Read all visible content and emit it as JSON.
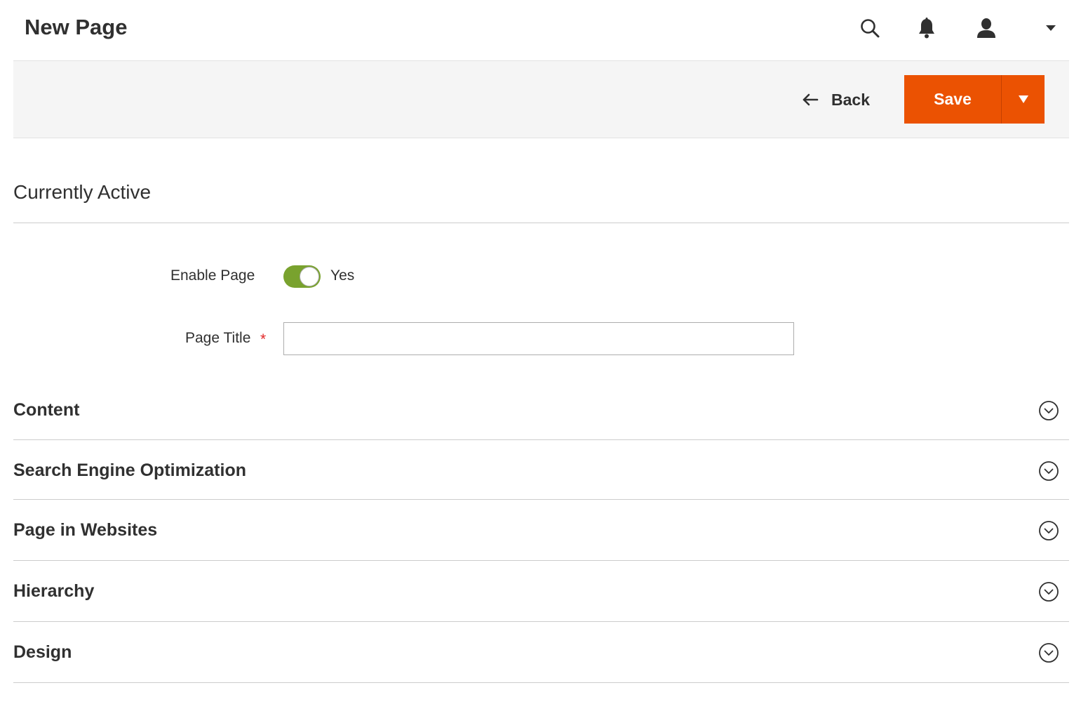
{
  "header": {
    "title": "New Page",
    "icons": [
      "search-icon",
      "bell-icon",
      "user-icon",
      "caret-down-icon"
    ]
  },
  "actions": {
    "back_label": "Back",
    "save_label": "Save"
  },
  "currently_active": {
    "title": "Currently Active",
    "enable_page_label": "Enable Page",
    "enable_page_value": "Yes",
    "enable_page_on": true,
    "page_title_label": "Page Title",
    "required_mark": "*",
    "page_title_value": "",
    "page_title_placeholder": ""
  },
  "sections": [
    {
      "label": "Content"
    },
    {
      "label": "Search Engine Optimization"
    },
    {
      "label": "Page in Websites"
    },
    {
      "label": "Hierarchy"
    },
    {
      "label": "Design"
    }
  ],
  "colors": {
    "accent": "#eb5202",
    "toggle_on": "#79a22e",
    "required": "#e22626",
    "text": "#303030"
  }
}
